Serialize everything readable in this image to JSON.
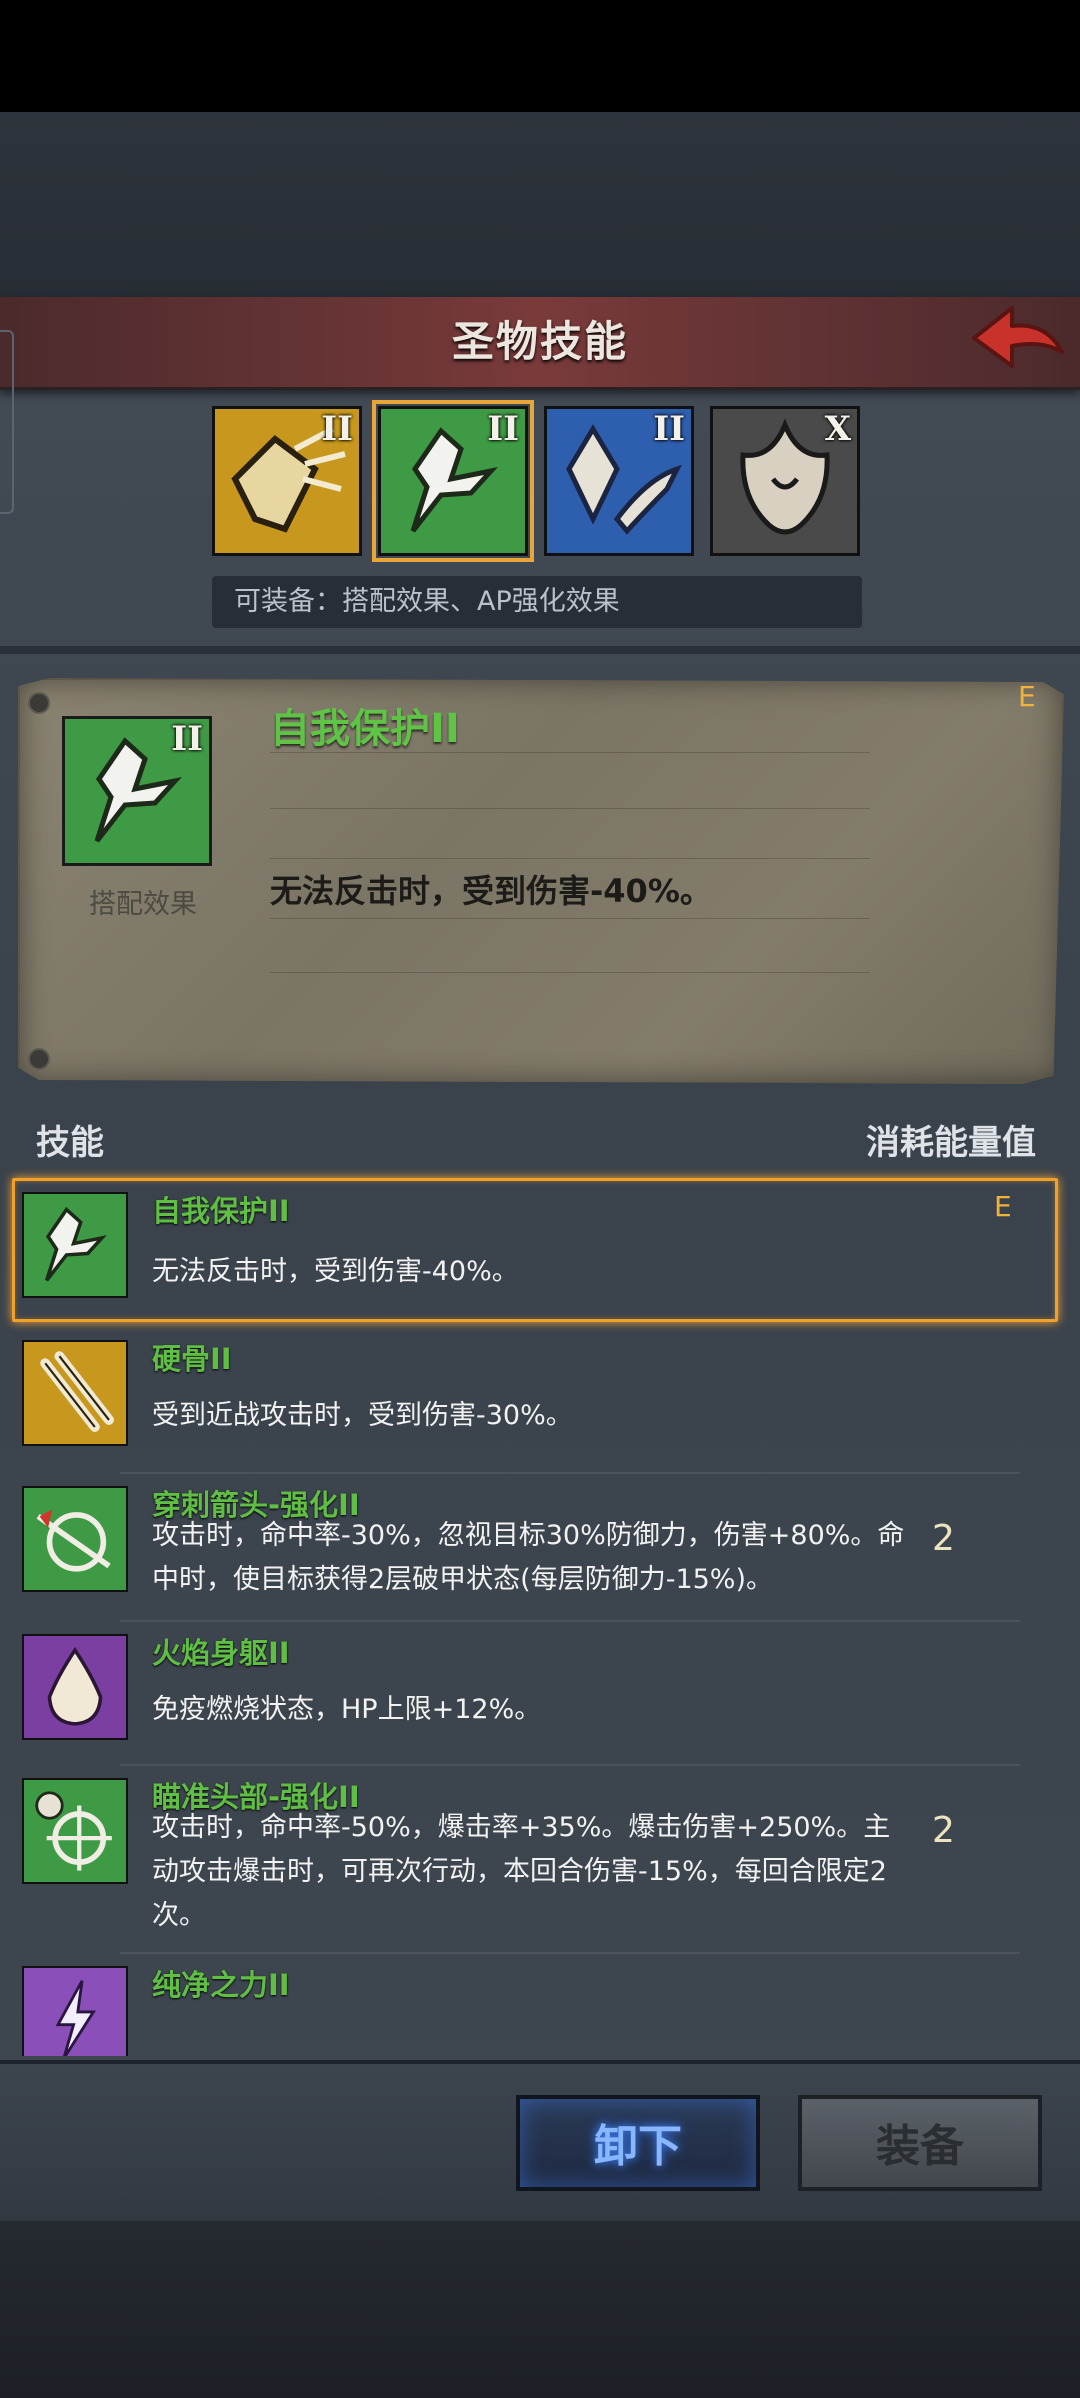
{
  "header": {
    "title": "圣物技能"
  },
  "relics": [
    {
      "rank": "II",
      "color": "#c8981e"
    },
    {
      "rank": "II",
      "color": "#3f9a45"
    },
    {
      "rank": "II",
      "color": "#2e5fae"
    },
    {
      "rank": "X",
      "color": "#4a4a4a"
    }
  ],
  "equip_hint": "可装备：搭配效果、AP强化效果",
  "detail": {
    "title": "自我保护II",
    "caption": "搭配效果",
    "description": "无法反击时，受到伤害-40%。",
    "grade": "E",
    "icon_rank": "II"
  },
  "list_header": {
    "skill": "技能",
    "cost": "消耗能量值"
  },
  "skills": [
    {
      "name": "自我保护II",
      "desc": "无法反击时，受到伤害-40%。",
      "cost": "",
      "grade": "E",
      "color": "#3f9a45"
    },
    {
      "name": "硬骨II",
      "desc": "受到近战攻击时，受到伤害-30%。",
      "cost": "",
      "grade": "",
      "color": "#c8981e"
    },
    {
      "name": "穿刺箭头-强化II",
      "desc": "攻击时，命中率-30%，忽视目标30%防御力，伤害+80%。命中时，使目标获得2层破甲状态(每层防御力-15%)。",
      "cost": "2",
      "grade": "",
      "color": "#3f9a45"
    },
    {
      "name": "火焰身躯II",
      "desc": "免疫燃烧状态，HP上限+12%。",
      "cost": "",
      "grade": "",
      "color": "#7a3fa0"
    },
    {
      "name": "瞄准头部-强化II",
      "desc": "攻击时，命中率-50%，爆击率+35%。爆击伤害+250%。主动攻击爆击时，可再次行动，本回合伤害-15%，每回合限定2次。",
      "cost": "2",
      "grade": "",
      "color": "#3f9a45"
    },
    {
      "name": "纯净之力II",
      "desc": "",
      "cost": "",
      "grade": "",
      "color": "#8a4fb8"
    }
  ],
  "buttons": {
    "unequip": "卸下",
    "equip": "装备"
  }
}
